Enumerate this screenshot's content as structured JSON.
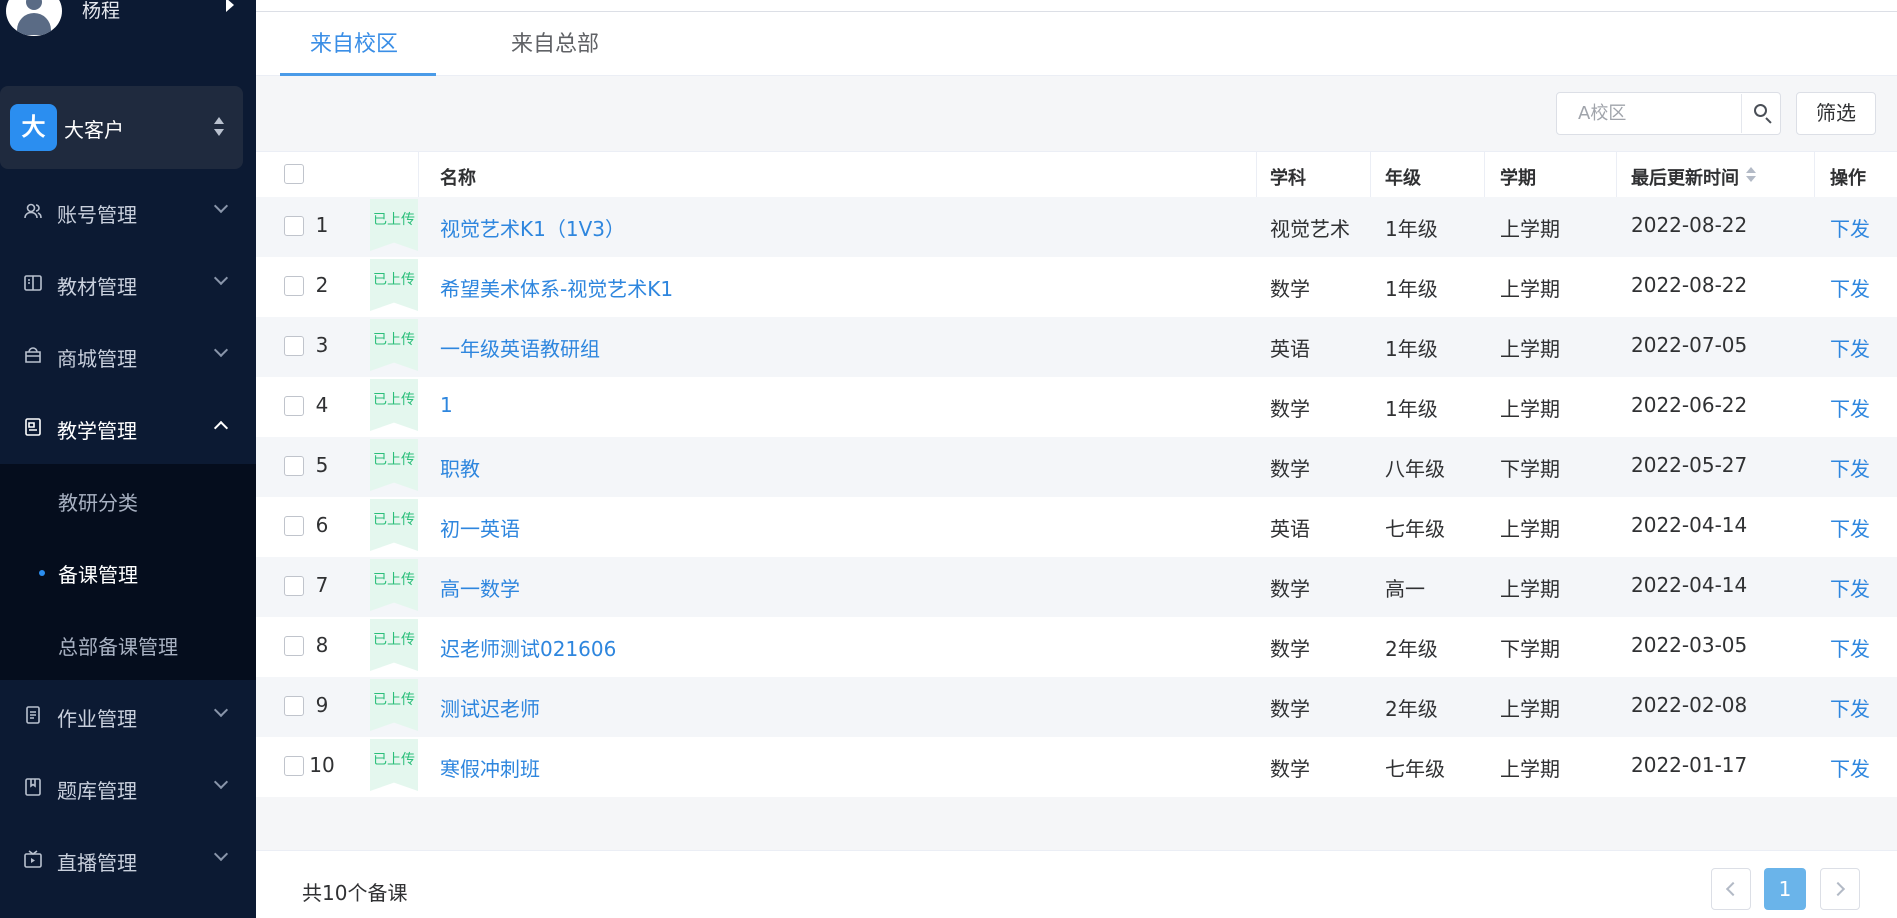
{
  "sidebar": {
    "user": {
      "name": "杨程"
    },
    "org": {
      "badge": "大",
      "name": "大客户"
    },
    "menu": [
      {
        "label": "账号管理",
        "icon": "user-icon"
      },
      {
        "label": "教材管理",
        "icon": "book-icon"
      },
      {
        "label": "商城管理",
        "icon": "shop-icon"
      },
      {
        "label": "教学管理",
        "icon": "teaching-icon",
        "open": true
      },
      {
        "label": "作业管理",
        "icon": "homework-icon"
      },
      {
        "label": "题库管理",
        "icon": "question-bank-icon"
      },
      {
        "label": "直播管理",
        "icon": "live-icon"
      }
    ],
    "submenu": [
      {
        "label": "教研分类"
      },
      {
        "label": "备课管理",
        "active": true
      },
      {
        "label": "总部备课管理"
      }
    ]
  },
  "tabs": [
    {
      "label": "来自校区",
      "active": true
    },
    {
      "label": "来自总部"
    }
  ],
  "search": {
    "placeholder": "A校区"
  },
  "filter_label": "筛选",
  "table": {
    "headers": {
      "name": "名称",
      "subject": "学科",
      "grade": "年级",
      "term": "学期",
      "updated": "最后更新时间",
      "action": "操作"
    },
    "rows": [
      {
        "index": "1",
        "status": "已上传",
        "name": "视觉艺术K1（1V3）",
        "subject": "视觉艺术",
        "grade": "1年级",
        "term": "上学期",
        "updated": "2022-08-22",
        "action": "下发"
      },
      {
        "index": "2",
        "status": "已上传",
        "name": "希望美术体系-视觉艺术K1",
        "subject": "数学",
        "grade": "1年级",
        "term": "上学期",
        "updated": "2022-08-22",
        "action": "下发"
      },
      {
        "index": "3",
        "status": "已上传",
        "name": "一年级英语教研组",
        "subject": "英语",
        "grade": "1年级",
        "term": "上学期",
        "updated": "2022-07-05",
        "action": "下发"
      },
      {
        "index": "4",
        "status": "已上传",
        "name": "1",
        "subject": "数学",
        "grade": "1年级",
        "term": "上学期",
        "updated": "2022-06-22",
        "action": "下发"
      },
      {
        "index": "5",
        "status": "已上传",
        "name": "职教",
        "subject": "数学",
        "grade": "八年级",
        "term": "下学期",
        "updated": "2022-05-27",
        "action": "下发"
      },
      {
        "index": "6",
        "status": "已上传",
        "name": "初一英语",
        "subject": "英语",
        "grade": "七年级",
        "term": "上学期",
        "updated": "2022-04-14",
        "action": "下发"
      },
      {
        "index": "7",
        "status": "已上传",
        "name": "高一数学",
        "subject": "数学",
        "grade": "高一",
        "term": "上学期",
        "updated": "2022-04-14",
        "action": "下发"
      },
      {
        "index": "8",
        "status": "已上传",
        "name": "迟老师测试021606",
        "subject": "数学",
        "grade": "2年级",
        "term": "下学期",
        "updated": "2022-03-05",
        "action": "下发"
      },
      {
        "index": "9",
        "status": "已上传",
        "name": "测试迟老师",
        "subject": "数学",
        "grade": "2年级",
        "term": "上学期",
        "updated": "2022-02-08",
        "action": "下发"
      },
      {
        "index": "10",
        "status": "已上传",
        "name": "寒假冲刺班",
        "subject": "数学",
        "grade": "七年级",
        "term": "上学期",
        "updated": "2022-01-17",
        "action": "下发"
      }
    ]
  },
  "pagination": {
    "total_text": "共10个备课",
    "current_page": "1"
  }
}
